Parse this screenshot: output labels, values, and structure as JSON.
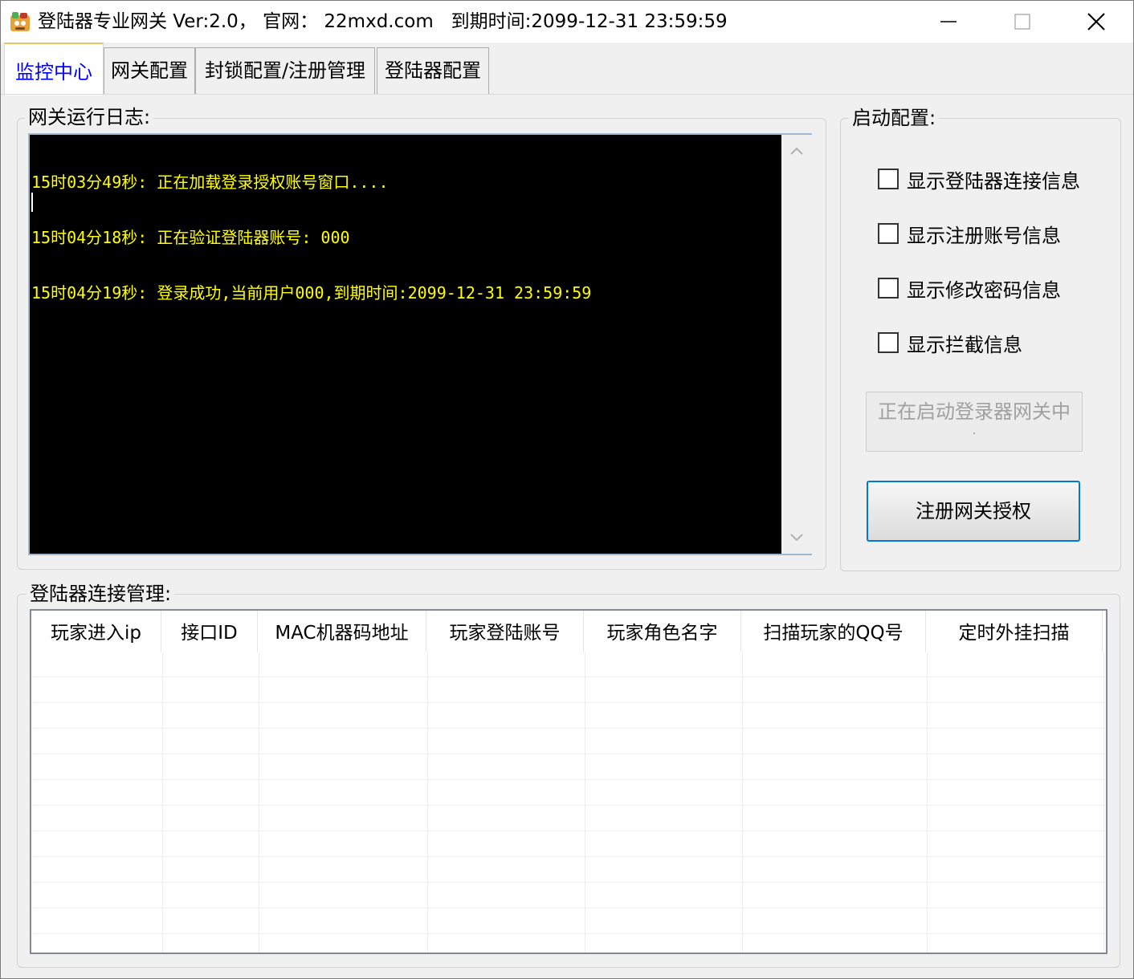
{
  "window": {
    "title": "登陆器专业网关 Ver:2.0， 官网： 22mxd.com   到期时间:2099-12-31 23:59:59"
  },
  "tabs": [
    {
      "label": "监控中心",
      "active": true
    },
    {
      "label": "网关配置",
      "active": false
    },
    {
      "label": "封锁配置/注册管理",
      "active": false
    },
    {
      "label": "登陆器配置",
      "active": false
    }
  ],
  "log_panel": {
    "title": "网关运行日志:",
    "lines": [
      "15时03分49秒: 正在加载登录授权账号窗口....",
      "15时04分18秒: 正在验证登陆器账号: 000",
      "15时04分19秒: 登录成功,当前用户000,到期时间:2099-12-31 23:59:59"
    ],
    "text_color": "#ffff00",
    "bg_color": "#000000"
  },
  "start_config": {
    "title": "启动配置:",
    "checkboxes": [
      {
        "label": "显示登陆器连接信息",
        "checked": false
      },
      {
        "label": "显示注册账号信息",
        "checked": false
      },
      {
        "label": "显示修改密码信息",
        "checked": false
      },
      {
        "label": "显示拦截信息",
        "checked": false
      }
    ],
    "status_button": {
      "label": "正在启动登录器网关中",
      "trailing_dot": ".",
      "disabled": true
    },
    "register_button": {
      "label": "注册网关授权"
    }
  },
  "connections": {
    "title": "登陆器连接管理:",
    "columns": [
      "玩家进入ip",
      "接口ID",
      "MAC机器码地址",
      "玩家登陆账号",
      "玩家角色名字",
      "扫描玩家的QQ号",
      "定时外挂扫描"
    ],
    "rows": []
  },
  "colors": {
    "active_tab_text": "#0000ff",
    "focus_border": "#0078d7"
  }
}
